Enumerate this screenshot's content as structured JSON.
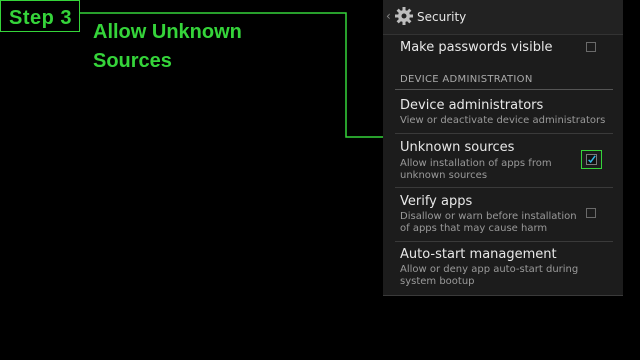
{
  "annotation": {
    "step_label": "Step 3",
    "title": "Allow Unknown Sources",
    "accent_color": "#35d43a"
  },
  "action_bar": {
    "back_icon": "chevron-left-icon",
    "icon": "gear-icon",
    "title": "Security"
  },
  "settings": {
    "make_passwords_visible": {
      "title": "Make passwords visible",
      "checked": false
    },
    "section_header": "DEVICE ADMINISTRATION",
    "device_administrators": {
      "title": "Device administrators",
      "summary": "View or deactivate device administrators"
    },
    "unknown_sources": {
      "title": "Unknown sources",
      "summary": "Allow installation of apps from unknown sources",
      "checked": true
    },
    "verify_apps": {
      "title": "Verify apps",
      "summary": "Disallow or warn before installation of apps that may cause harm",
      "checked": false
    },
    "auto_start": {
      "title": "Auto-start management",
      "summary": "Allow or deny app auto-start during system bootup"
    }
  }
}
